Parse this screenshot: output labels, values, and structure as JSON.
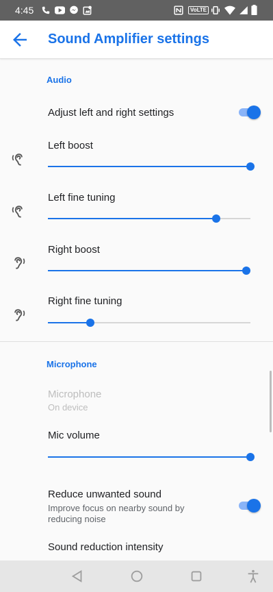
{
  "status_bar": {
    "time": "4:45",
    "left_icons": [
      "phone-icon",
      "youtube-icon",
      "messenger-icon",
      "notification-icon"
    ],
    "right_icons": [
      "nfc-icon",
      "volte-icon",
      "vibrate-icon",
      "wifi-icon",
      "signal-icon",
      "battery-icon"
    ],
    "volte_label": "VoLTE"
  },
  "app_bar": {
    "title": "Sound Amplifier settings",
    "back_icon": "arrow-back-icon"
  },
  "audio": {
    "header": "Audio",
    "adjust_toggle": {
      "label": "Adjust left and right settings",
      "on": true
    },
    "left_boost": {
      "label": "Left boost",
      "value": 1.0
    },
    "left_fine": {
      "label": "Left fine tuning",
      "value": 0.83
    },
    "right_boost": {
      "label": "Right boost",
      "value": 0.98
    },
    "right_fine": {
      "label": "Right fine tuning",
      "value": 0.21
    }
  },
  "microphone": {
    "header": "Microphone",
    "source": {
      "label": "Microphone",
      "value": "On device"
    },
    "mic_volume": {
      "label": "Mic volume",
      "value": 1.0
    },
    "reduce_sound": {
      "label": "Reduce unwanted sound",
      "description": "Improve focus on nearby sound by reducing noise",
      "on": true
    },
    "reduction_intensity": {
      "label": "Sound reduction intensity"
    }
  },
  "colors": {
    "accent": "#1a73e8",
    "accent_light": "#8ab4f8",
    "status_bar": "#616161"
  },
  "nav_bar": [
    "back-triangle-icon",
    "home-circle-icon",
    "recents-square-icon",
    "accessibility-icon"
  ]
}
